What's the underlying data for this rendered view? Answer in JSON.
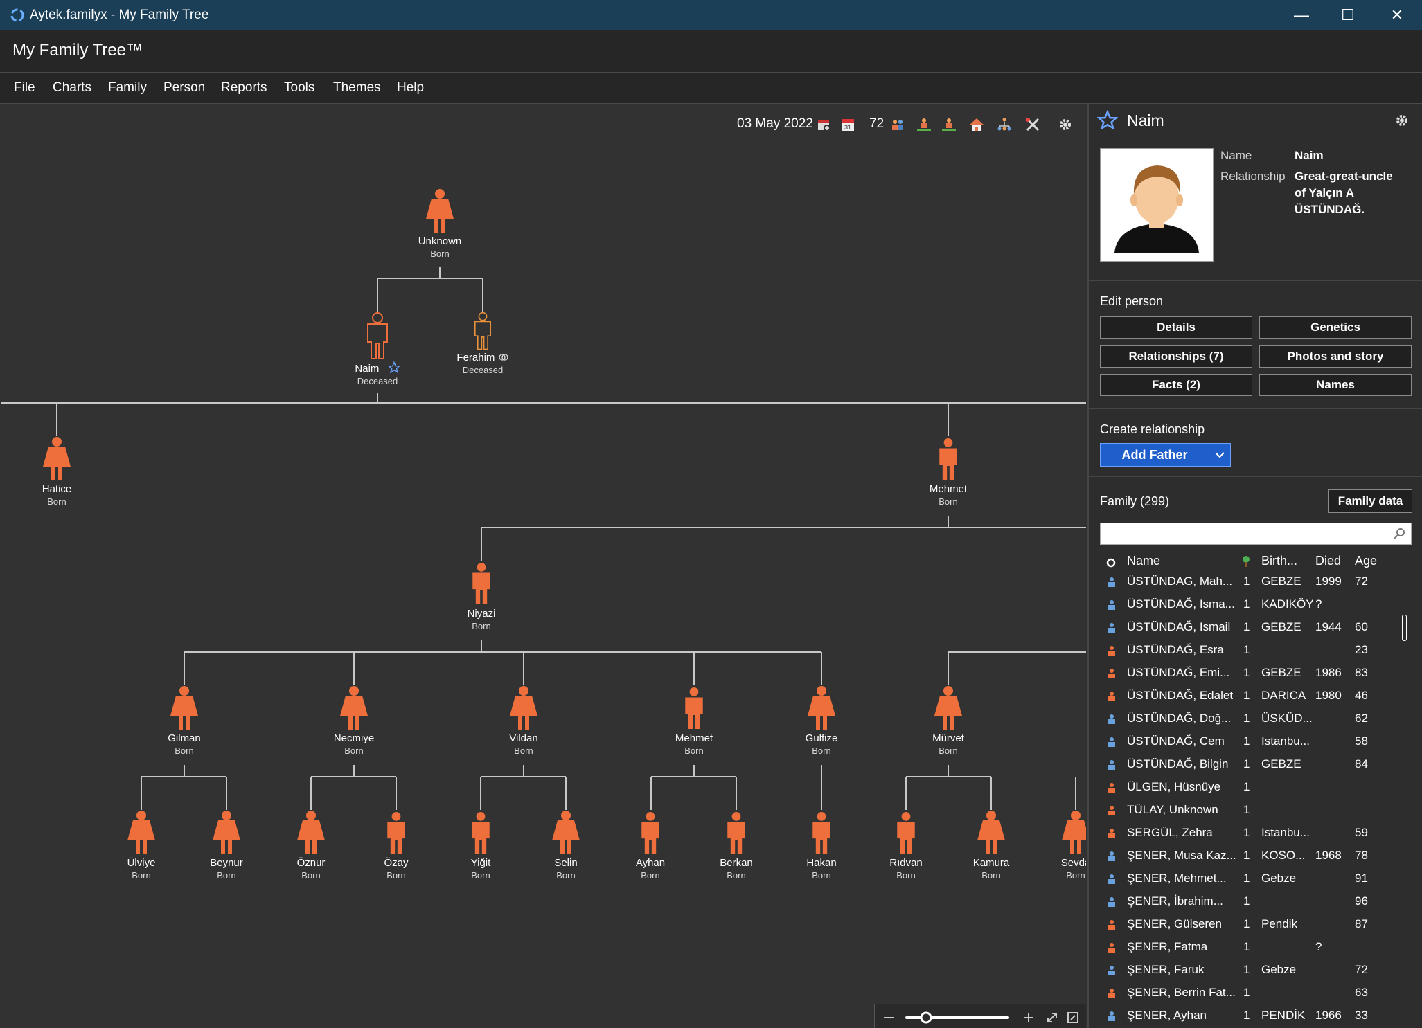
{
  "window": {
    "title": "Aytek.familyx - My Family Tree",
    "minimize": "—",
    "maximize": "☐",
    "close": "✕"
  },
  "app": {
    "title": "My Family Tree™"
  },
  "menu": [
    "File",
    "Charts",
    "Family",
    "Person",
    "Reports",
    "Tools",
    "Themes",
    "Help"
  ],
  "toolbar": {
    "date": "03 May 2022",
    "count": "72"
  },
  "chart": {
    "people": {
      "unknown": {
        "name": "Unknown",
        "status": "Born"
      },
      "naim": {
        "name": "Naim",
        "status": "Deceased"
      },
      "ferahim": {
        "name": "Ferahim",
        "status": "Deceased"
      },
      "hatice": {
        "name": "Hatice",
        "status": "Born"
      },
      "mehmet1": {
        "name": "Mehmet",
        "status": "Born"
      },
      "niyazi": {
        "name": "Niyazi",
        "status": "Born"
      },
      "gilman": {
        "name": "Gilman",
        "status": "Born"
      },
      "necmiye": {
        "name": "Necmiye",
        "status": "Born"
      },
      "vildan": {
        "name": "Vildan",
        "status": "Born"
      },
      "mehmet2": {
        "name": "Mehmet",
        "status": "Born"
      },
      "gulfize": {
        "name": "Gulfize",
        "status": "Born"
      },
      "murvet": {
        "name": "Mürvet",
        "status": "Born"
      },
      "ulviye": {
        "name": "Ülviye",
        "status": "Born"
      },
      "beynur": {
        "name": "Beynur",
        "status": "Born"
      },
      "oznur": {
        "name": "Öznur",
        "status": "Born"
      },
      "ozay": {
        "name": "Özay",
        "status": "Born"
      },
      "yigit": {
        "name": "Yiğit",
        "status": "Born"
      },
      "selin": {
        "name": "Selin",
        "status": "Born"
      },
      "ayhan": {
        "name": "Ayhan",
        "status": "Born"
      },
      "berkan": {
        "name": "Berkan",
        "status": "Born"
      },
      "hakan": {
        "name": "Hakan",
        "status": "Born"
      },
      "ridvan": {
        "name": "Rıdvan",
        "status": "Born"
      },
      "kamura": {
        "name": "Kamura",
        "status": "Born"
      },
      "sevda": {
        "name": "Sevda",
        "status": "Born"
      }
    }
  },
  "panel": {
    "person_name": "Naim",
    "name_label": "Name",
    "name_value": "Naim",
    "relationship_label": "Relationship",
    "relationship_line1": "Great-great-uncle",
    "relationship_line2": "of Yalçın A",
    "relationship_line3": "ÜSTÜNDAĞ.",
    "edit_title": "Edit person",
    "buttons": {
      "details": "Details",
      "genetics": "Genetics",
      "relationships": "Relationships (7)",
      "photos": "Photos and story",
      "facts": "Facts (2)",
      "names": "Names"
    },
    "create_title": "Create relationship",
    "add_father": "Add Father",
    "family_title": "Family (299)",
    "family_data": "Family data",
    "columns": {
      "name": "Name",
      "birth": "Birth...",
      "died": "Died",
      "age": "Age"
    },
    "rows": [
      {
        "name": "ÜSTÜNDAG, Mah...",
        "gen": "1",
        "birth": "GEBZE",
        "died": "1999",
        "age": "72",
        "sex": "m"
      },
      {
        "name": "ÜSTÜNDAĞ, Isma...",
        "gen": "1",
        "birth": "KADIKÖY",
        "died": "?",
        "age": "",
        "sex": "m"
      },
      {
        "name": "ÜSTÜNDAĞ, Ismail",
        "gen": "1",
        "birth": "GEBZE",
        "died": "1944",
        "age": "60",
        "sex": "m"
      },
      {
        "name": "ÜSTÜNDAĞ, Esra",
        "gen": "1",
        "birth": "",
        "died": "",
        "age": "23",
        "sex": "f"
      },
      {
        "name": "ÜSTÜNDAĞ, Emi...",
        "gen": "1",
        "birth": "GEBZE",
        "died": "1986",
        "age": "83",
        "sex": "f"
      },
      {
        "name": "ÜSTÜNDAĞ, Edalet",
        "gen": "1",
        "birth": "DARICA",
        "died": "1980",
        "age": "46",
        "sex": "f"
      },
      {
        "name": "ÜSTÜNDAĞ, Doğ...",
        "gen": "1",
        "birth": "ÜSKÜD...",
        "died": "",
        "age": "62",
        "sex": "m"
      },
      {
        "name": "ÜSTÜNDAĞ, Cem",
        "gen": "1",
        "birth": "Istanbu...",
        "died": "",
        "age": "58",
        "sex": "m"
      },
      {
        "name": "ÜSTÜNDAĞ, Bilgin",
        "gen": "1",
        "birth": "GEBZE",
        "died": "",
        "age": "84",
        "sex": "m"
      },
      {
        "name": "ÜLGEN, Hüsnüye",
        "gen": "1",
        "birth": "",
        "died": "",
        "age": "",
        "sex": "f"
      },
      {
        "name": "TÜLAY, Unknown",
        "gen": "1",
        "birth": "",
        "died": "",
        "age": "",
        "sex": "f"
      },
      {
        "name": "SERGÜL, Zehra",
        "gen": "1",
        "birth": "Istanbu...",
        "died": "",
        "age": "59",
        "sex": "f"
      },
      {
        "name": "ŞENER, Musa Kaz...",
        "gen": "1",
        "birth": "KOSO...",
        "died": "1968",
        "age": "78",
        "sex": "m"
      },
      {
        "name": "ŞENER, Mehmet...",
        "gen": "1",
        "birth": "Gebze",
        "died": "",
        "age": "91",
        "sex": "m"
      },
      {
        "name": "ŞENER, İbrahim...",
        "gen": "1",
        "birth": "",
        "died": "",
        "age": "96",
        "sex": "m"
      },
      {
        "name": "ŞENER, Gülseren",
        "gen": "1",
        "birth": "Pendik",
        "died": "",
        "age": "87",
        "sex": "f"
      },
      {
        "name": "ŞENER, Fatma",
        "gen": "1",
        "birth": "",
        "died": "?",
        "age": "",
        "sex": "f"
      },
      {
        "name": "ŞENER, Faruk",
        "gen": "1",
        "birth": "Gebze",
        "died": "",
        "age": "72",
        "sex": "m"
      },
      {
        "name": "ŞENER, Berrin Fat...",
        "gen": "1",
        "birth": "",
        "died": "",
        "age": "63",
        "sex": "f"
      },
      {
        "name": "ŞENER, Ayhan",
        "gen": "1",
        "birth": "PENDİK",
        "died": "1966",
        "age": "33",
        "sex": "m"
      }
    ]
  }
}
